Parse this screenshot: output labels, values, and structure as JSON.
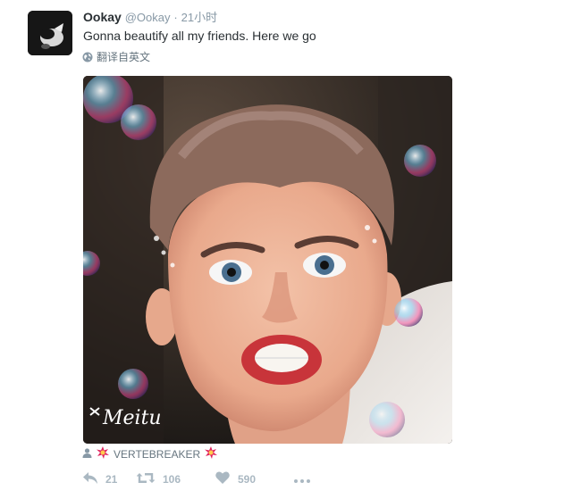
{
  "tweet": {
    "author_name": "Ookay",
    "author_handle": "@Ookay",
    "separator": "·",
    "time": "21小时",
    "text": "Gonna beautify all my friends. Here we go",
    "translate_label": "翻译自英文"
  },
  "media": {
    "watermark": "Meitu",
    "tag_label": "VERTEBREAKER"
  },
  "actions": {
    "reply_count": "21",
    "retweet_count": "106",
    "like_count": "590"
  },
  "colors": {
    "text": "#292f33",
    "muted": "#8899a6",
    "action_icon": "#aab8c2",
    "tag_emoji": "#e0245e"
  },
  "icons": {
    "translate": "globe-icon",
    "tag": "person-icon",
    "reply": "reply-icon",
    "retweet": "retweet-icon",
    "like": "heart-icon",
    "more": "more-icon"
  }
}
